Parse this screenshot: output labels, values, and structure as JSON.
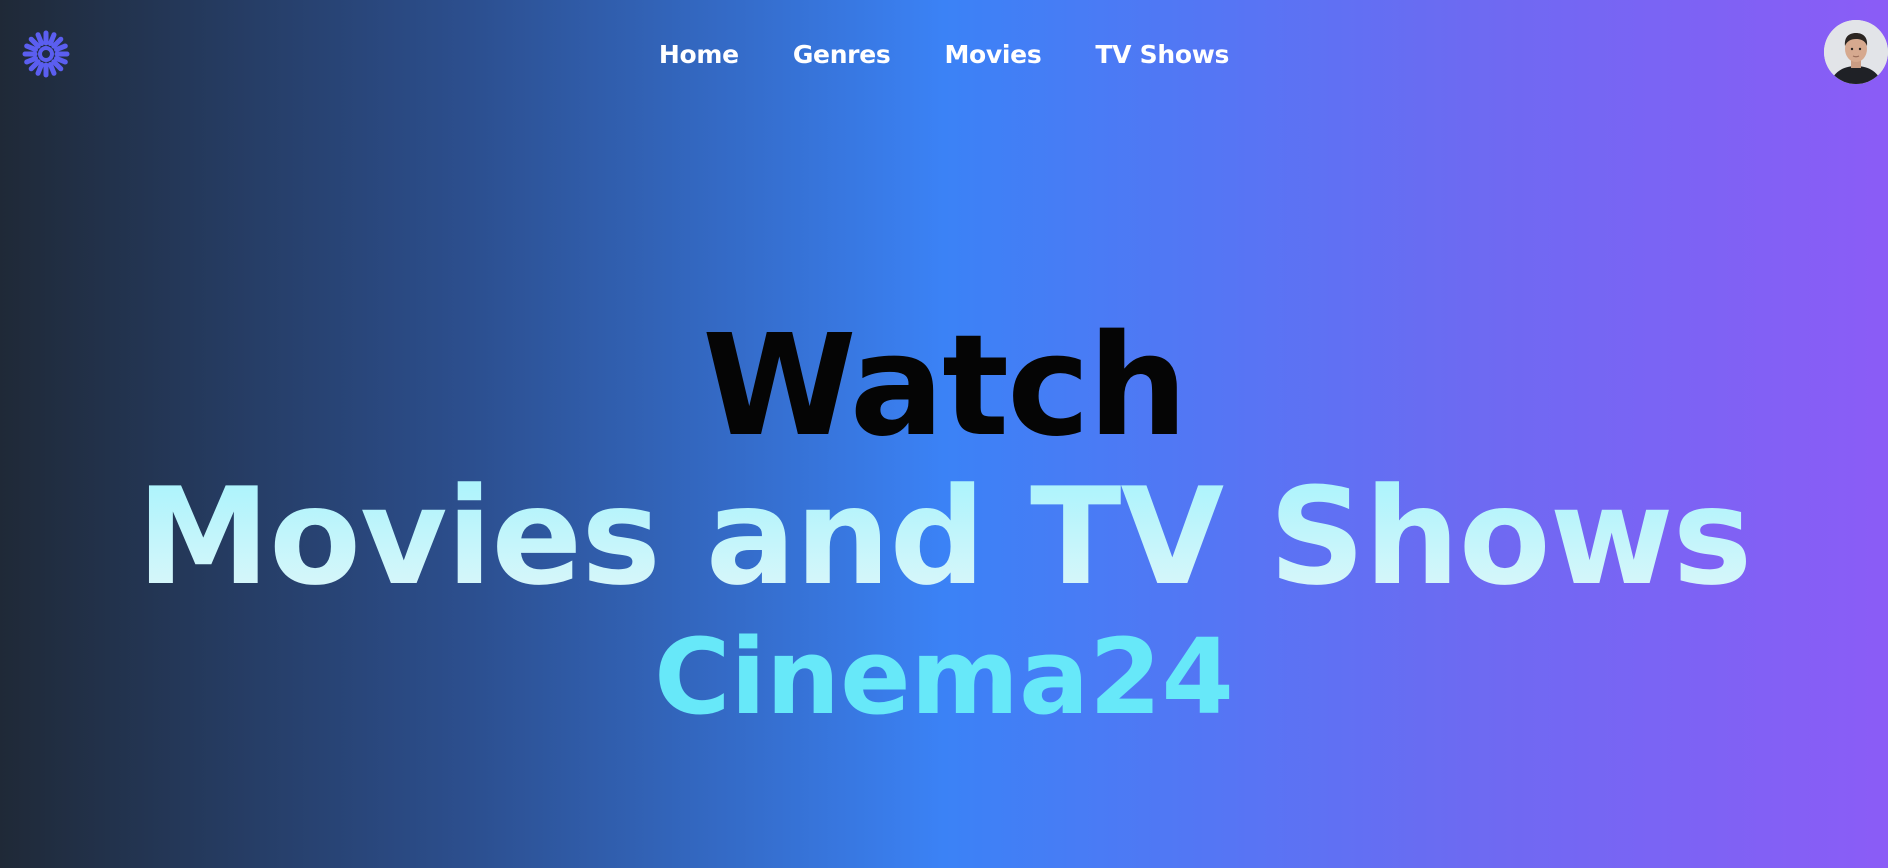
{
  "nav": {
    "items": [
      {
        "label": "Home"
      },
      {
        "label": "Genres"
      },
      {
        "label": "Movies"
      },
      {
        "label": "TV Shows"
      }
    ]
  },
  "hero": {
    "line1": "Watch",
    "line2": "Movies and TV Shows",
    "brand": "Cinema24"
  },
  "colors": {
    "logo": "#5b5ef0",
    "brand_text": "#67e8f9",
    "headline_dark": "#050505",
    "gradient_start": "#1f2937",
    "gradient_end": "#8b5cf6"
  },
  "icons": {
    "logo": "sun-burst-logo-icon",
    "avatar": "user-avatar"
  }
}
